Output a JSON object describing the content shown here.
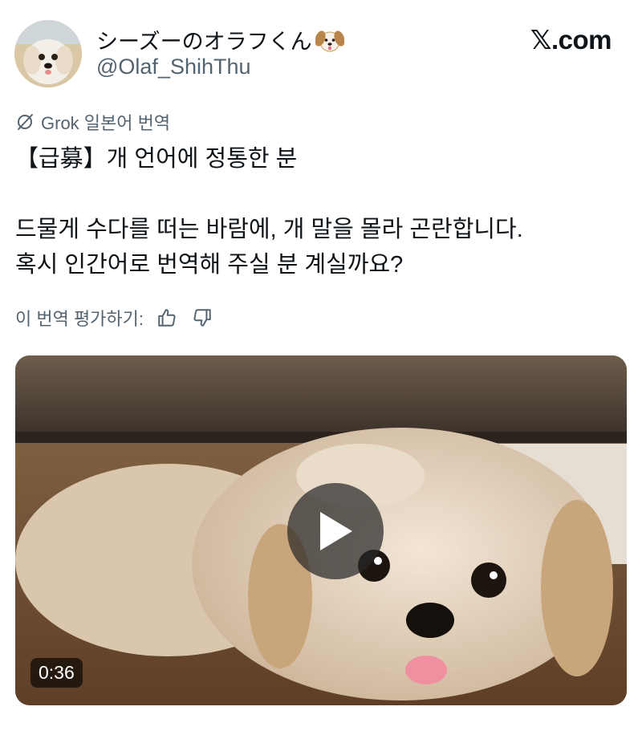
{
  "header": {
    "display_name": "シーズーのオラフくん",
    "handle": "@Olaf_ShihThu",
    "brand": "𝕏.com"
  },
  "translation": {
    "label": "Grok 일본어 번역"
  },
  "tweet": {
    "line1": "【급募】개 언어에 정통한 분",
    "line2": "드물게 수다를 떠는 바람에, 개 말을 몰라 곤란합니다.",
    "line3": "혹시 인간어로 번역해 주실 분 계실까요?"
  },
  "rating": {
    "label": "이 번역 평가하기:"
  },
  "media": {
    "duration": "0:36"
  },
  "icons": {
    "emoji": "dog-face-icon",
    "translate": "grok-icon",
    "like": "thumbs-up-icon",
    "dislike": "thumbs-down-icon",
    "play": "play-icon"
  },
  "colors": {
    "text": "#0f1419",
    "secondary": "#536471",
    "overlay": "#282828"
  }
}
